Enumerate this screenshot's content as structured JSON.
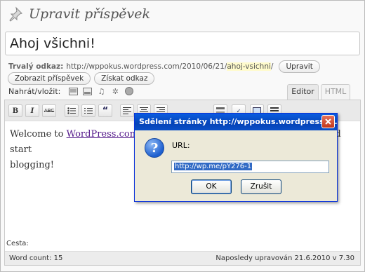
{
  "header": {
    "title": "Upravit příspěvek"
  },
  "post": {
    "title": "Ahoj všichni!"
  },
  "permalink": {
    "label": "Trvalý odkaz:",
    "url_prefix": "http://wppokus.wordpress.com/2010/06/21/",
    "slug": "ahoj-vsichni",
    "url_suffix": "/",
    "edit_button": "Upravit",
    "view_button": "Zobrazit příspěvek",
    "shortlink_button": "Získat odkaz"
  },
  "upload": {
    "label": "Nahrát/vložit:"
  },
  "tabs": {
    "editor": "Editor",
    "html": "HTML"
  },
  "toolbar": {
    "bold": "B",
    "italic": "I",
    "strike": "ABC",
    "quote": "“"
  },
  "content": {
    "before_link": "Welcome to ",
    "link": "WordPress.com",
    "middle": ". This is your first post. Edit or delete it and start",
    "second_line": "blogging!"
  },
  "path": {
    "label": "Cesta:"
  },
  "status": {
    "word_count": "Word count: 15",
    "last_modified": "Naposledy upravován 21.6.2010 v 7.30"
  },
  "dialog": {
    "title": "Sdělení stránky http://wppokus.wordpress.c...",
    "label": "URL:",
    "value": "http://wp.me/pY276-1",
    "ok": "OK",
    "cancel": "Zrušit"
  }
}
